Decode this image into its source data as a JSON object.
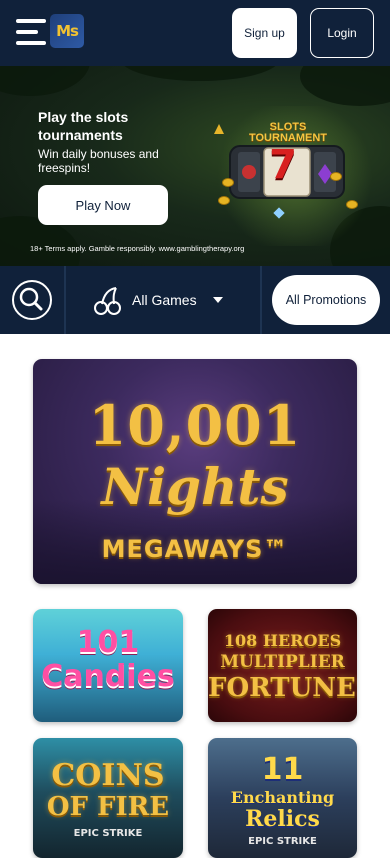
{
  "header": {
    "logo_text": "Ms",
    "signup_label": "Sign up",
    "login_label": "Login"
  },
  "banner": {
    "title": "Play the slots tournaments",
    "subtitle": "Win daily bonuses and freespins!",
    "cta_label": "Play Now",
    "terms": "18+ Terms apply. Gamble responsibly. www.gamblingtherapy.org",
    "machine_title_line1": "SLOTS",
    "machine_title_line2": "TOURNAMENT",
    "machine_symbol": "7"
  },
  "filters": {
    "category_label": "All Games",
    "promotions_label": "All Promotions"
  },
  "games": [
    {
      "line1": "10,001",
      "line2": "Nights",
      "line3": "MEGAWAYS™"
    },
    {
      "line1": "101",
      "line2": "Candies"
    },
    {
      "line1": "108 HEROES",
      "line2": "MULTIPLIER",
      "line3": "FORTUNES"
    },
    {
      "line1": "COINS",
      "line2": "OF FIRE",
      "line3": "EPIC STRIKE"
    },
    {
      "line1": "11",
      "line2": "Enchanting",
      "line3": "Relics",
      "line4": "EPIC STRIKE"
    }
  ],
  "colors": {
    "navy": "#10213a",
    "gold": "#f3c044",
    "white": "#ffffff"
  }
}
